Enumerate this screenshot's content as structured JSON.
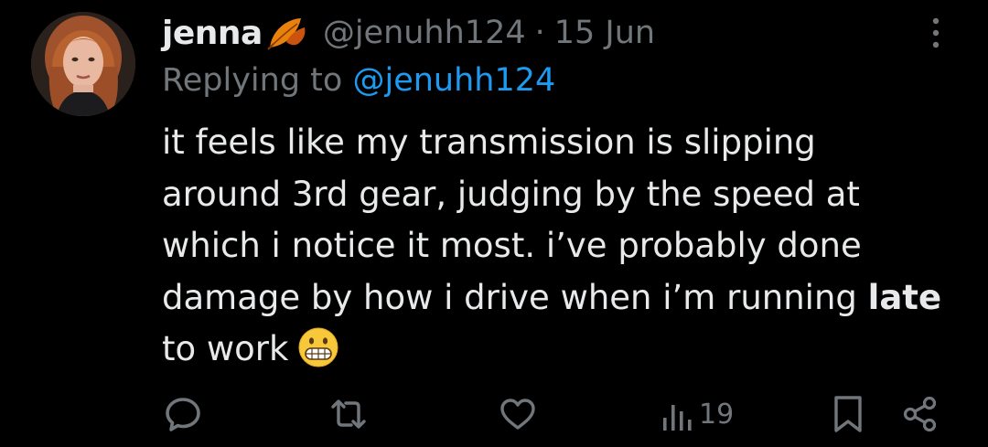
{
  "tweet": {
    "display_name": "jenna",
    "handle": "@jenuhh124",
    "separator": "·",
    "date": "15 Jun",
    "reply_prefix": "Replying to",
    "reply_handle": "@jenuhh124",
    "body_lines": [
      "it feels like my transmission is slipping",
      "around 3rd gear, judging by the speed at",
      "which i notice it most. i’ve probably done"
    ],
    "body_line4_prefix": "damage by how i drive when i’m running ",
    "body_line4_bold": "late",
    "body_line5": "to work",
    "emoji": "grimacing-face-emoji"
  },
  "actions": {
    "views_count": "19"
  },
  "colors": {
    "background": "#000000",
    "primary_text": "#e7e9ea",
    "secondary_text": "#71767b",
    "link": "#1d9bf0"
  },
  "icons": [
    "avatar",
    "leaf-emoji-icon",
    "more-icon",
    "reply-icon",
    "retweet-icon",
    "like-icon",
    "views-icon",
    "bookmark-icon",
    "share-icon"
  ]
}
